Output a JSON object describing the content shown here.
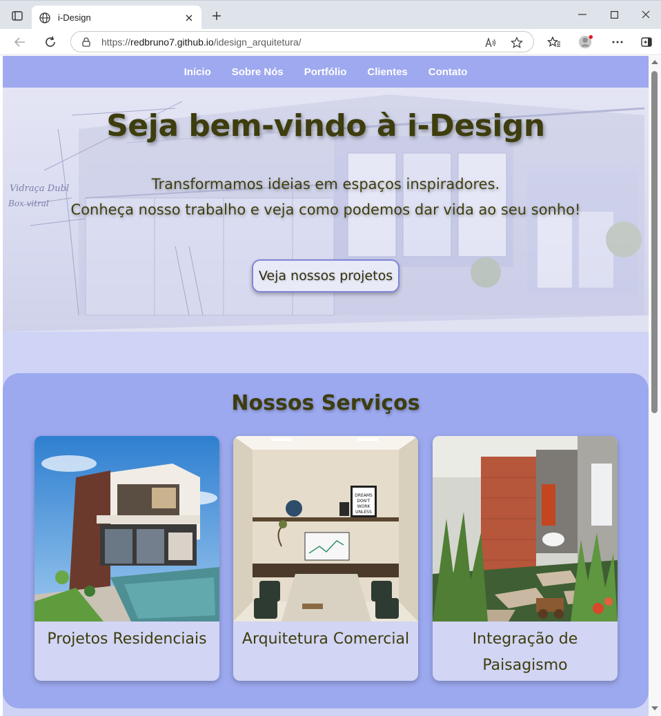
{
  "browser": {
    "tab_title": "i-Design",
    "url_prefix": "https://",
    "url_host": "redbruno7.github.io",
    "url_path": "/idesign_arquitetura/"
  },
  "nav": {
    "items": [
      "Início",
      "Sobre Nós",
      "Portfólio",
      "Clientes",
      "Contato"
    ]
  },
  "hero": {
    "title": "Seja bem-vindo à i-Design",
    "line1": "Transformamos ideias em espaços inspiradores.",
    "line2": "Conheça nosso trabalho e veja como podemos dar vida ao seu sonho!",
    "cta_label": "Veja nossos projetos"
  },
  "services": {
    "heading": "Nossos Serviços",
    "cards": [
      {
        "label": "Projetos Residenciais"
      },
      {
        "label": "Arquitetura Comercial"
      },
      {
        "label": "Integração de Paisagismo"
      }
    ]
  },
  "colors": {
    "nav_bg": "#9ea9ef",
    "section_bg": "#9ca9ef",
    "page_bg": "#cfd3f5",
    "text_olive": "#3d3d0e"
  },
  "icons": [
    "tab-actions-icon",
    "globe-icon",
    "close-icon",
    "plus-icon",
    "minimize-icon",
    "maximize-icon",
    "back-icon",
    "refresh-icon",
    "lock-icon",
    "read-aloud-icon",
    "favorite-icon",
    "favorites-icon",
    "profile-icon",
    "more-icon",
    "sidebar-icon"
  ]
}
